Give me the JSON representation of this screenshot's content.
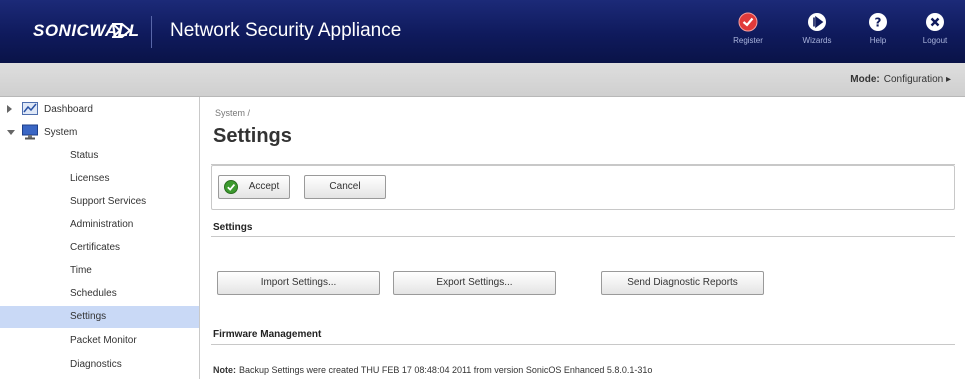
{
  "header": {
    "logo_text": "SONICWALL",
    "app_title": "Network Security Appliance",
    "buttons": [
      {
        "label": "Register",
        "icon": "register-icon",
        "color": "#e03a3a"
      },
      {
        "label": "Wizards",
        "icon": "wizards-icon",
        "color": "#ffffff"
      },
      {
        "label": "Help",
        "icon": "help-icon",
        "color": "#ffffff"
      },
      {
        "label": "Logout",
        "icon": "logout-icon",
        "color": "#ffffff"
      }
    ]
  },
  "modebar": {
    "mode_label": "Mode:",
    "mode_value": "Configuration ▸"
  },
  "sidebar": {
    "items": [
      {
        "label": "Dashboard"
      },
      {
        "label": "System"
      },
      {
        "label": "Status"
      },
      {
        "label": "Licenses"
      },
      {
        "label": "Support Services"
      },
      {
        "label": "Administration"
      },
      {
        "label": "Certificates"
      },
      {
        "label": "Time"
      },
      {
        "label": "Schedules"
      },
      {
        "label": "Settings"
      },
      {
        "label": "Packet Monitor"
      },
      {
        "label": "Diagnostics"
      }
    ]
  },
  "main": {
    "breadcrumb": "System /",
    "title": "Settings",
    "accept_label": "Accept",
    "cancel_label": "Cancel",
    "settings_section": "Settings",
    "import_label": "Import Settings...",
    "export_label": "Export Settings...",
    "diagnostic_label": "Send Diagnostic Reports",
    "firmware_section": "Firmware Management",
    "note_label": "Note:",
    "note_text": "Backup Settings were created THU FEB 17 08:48:04 2011 from version SonicOS Enhanced 5.8.0.1-31o"
  },
  "colors": {
    "header_bg": "#0f1a5c",
    "active_nav_bg": "#c9d9f6",
    "accept_icon": "#3c9a2e"
  }
}
